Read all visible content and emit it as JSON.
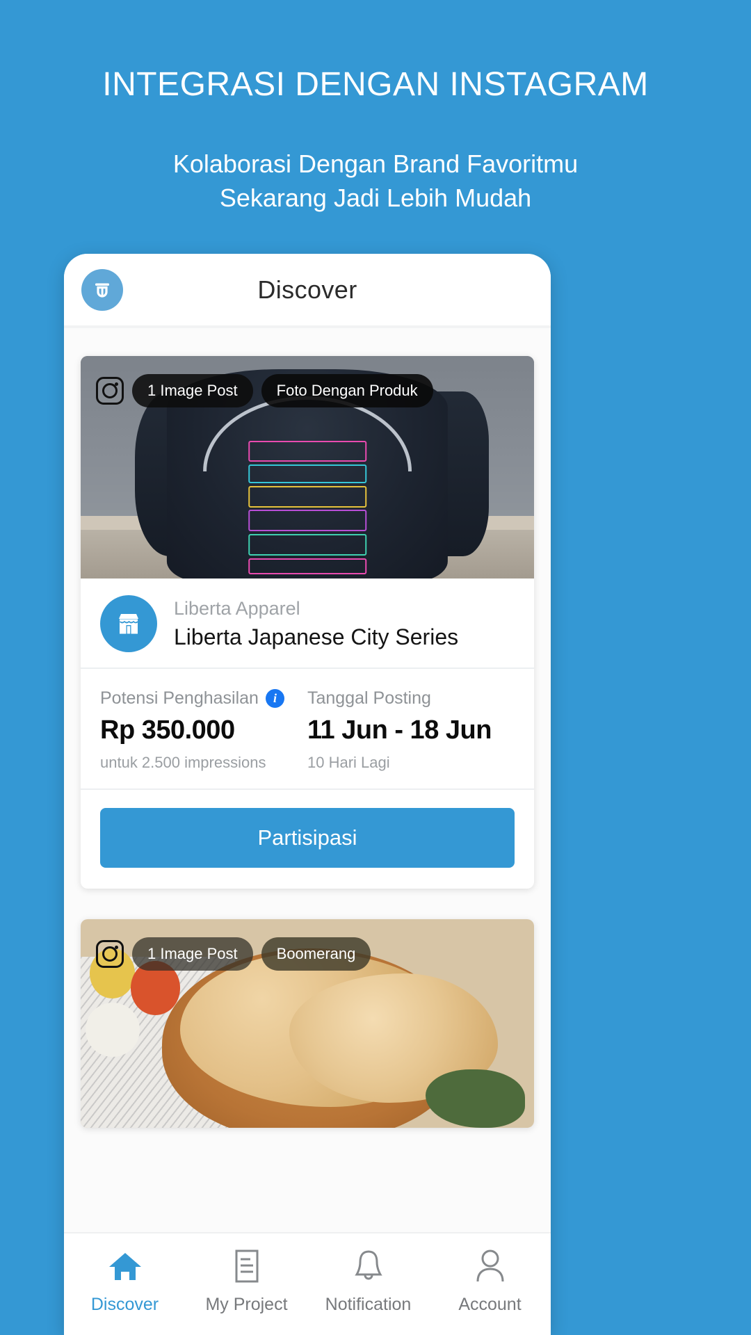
{
  "promo": {
    "title": "INTEGRASI DENGAN INSTAGRAM",
    "subtitle_line1": "Kolaborasi Dengan Brand Favoritmu",
    "subtitle_line2": "Sekarang Jadi Lebih Mudah",
    "background_color": "#3498d4",
    "text_color": "#ffffff"
  },
  "app": {
    "logo_icon": "app-logo-icon",
    "title": "Discover",
    "accent_color": "#3498d4"
  },
  "cards": [
    {
      "media": {
        "instagram_icon": "instagram-icon",
        "badges": [
          "1 Image Post",
          "Foto Dengan Produk"
        ],
        "alt_text": "SHIBUYA neon city jacket"
      },
      "store": {
        "icon": "storefront-icon",
        "name": "Liberta Apparel",
        "campaign": "Liberta Japanese City Series"
      },
      "stats": [
        {
          "label": "Potensi Penghasilan",
          "info_icon": "info-icon",
          "value": "Rp 350.000",
          "sub": "untuk 2.500 impressions"
        },
        {
          "label": "Tanggal Posting",
          "value": "11 Jun - 18 Jun",
          "sub": "10 Hari Lagi"
        }
      ],
      "cta_label": "Partisipasi"
    },
    {
      "media": {
        "instagram_icon": "instagram-icon",
        "badges": [
          "1 Image Post",
          "Boomerang"
        ],
        "alt_text": "Kerupuk in wooden bowl"
      }
    }
  ],
  "bottom_nav": {
    "items": [
      {
        "icon": "home-icon",
        "label": "Discover",
        "active": true
      },
      {
        "icon": "document-icon",
        "label": "My Project",
        "active": false
      },
      {
        "icon": "bell-icon",
        "label": "Notification",
        "active": false
      },
      {
        "icon": "person-icon",
        "label": "Account",
        "active": false
      }
    ]
  }
}
